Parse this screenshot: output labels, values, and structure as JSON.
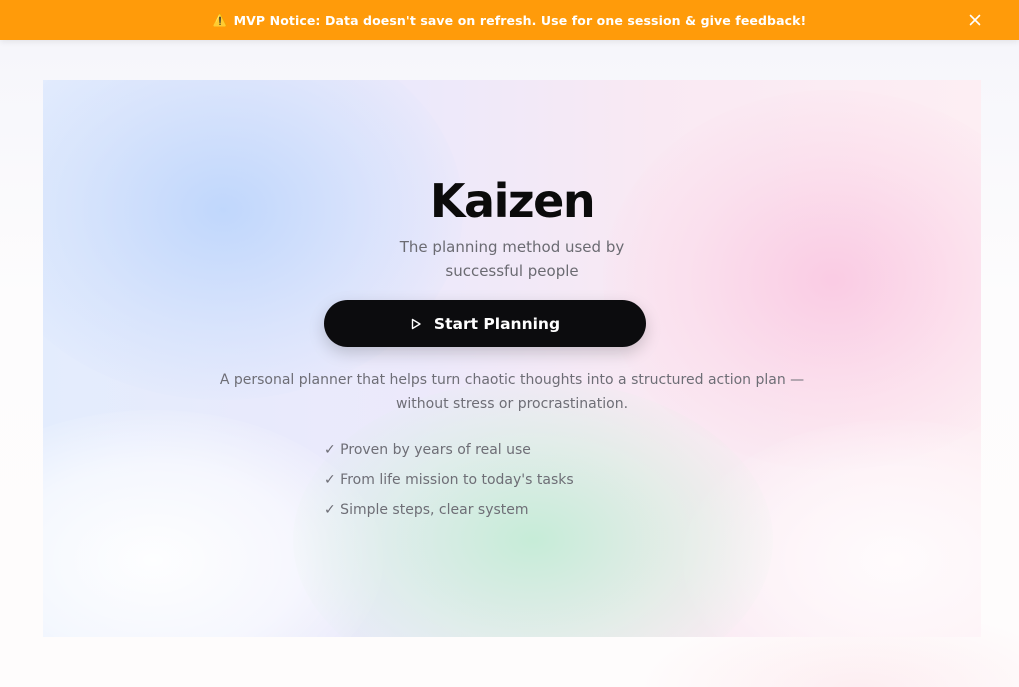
{
  "notice": {
    "icon": "warning-icon",
    "icon_glyph": "⚠️",
    "text": "MVP Notice: Data doesn't save on refresh. Use for one session & give feedback!",
    "close_icon": "close-icon",
    "color": "#ff9b0a"
  },
  "hero": {
    "title": "Kaizen",
    "subtitle": "The planning method used by successful people",
    "cta": {
      "label": "Start Planning",
      "icon": "play-icon"
    },
    "description": "A personal planner that helps turn chaotic thoughts into a structured action plan — without stress or procrastination.",
    "features": [
      "✓ Proven by years of real use",
      "✓ From life mission to today's tasks",
      "✓ Simple steps, clear system"
    ]
  }
}
